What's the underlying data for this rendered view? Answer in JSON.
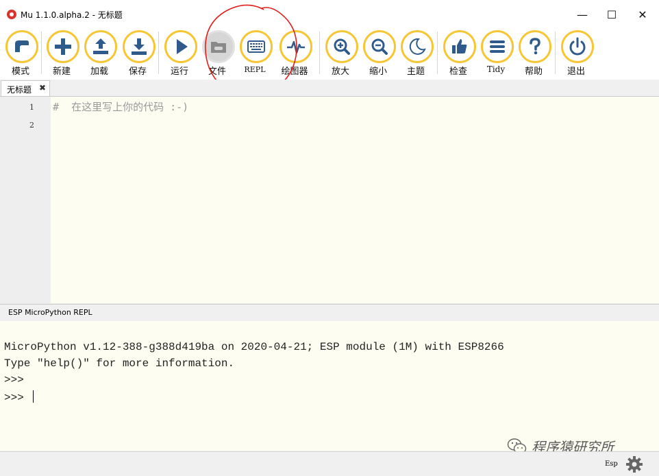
{
  "window": {
    "title": "Mu 1.1.0.alpha.2 - 无标题",
    "minimize": "—",
    "maximize": "☐",
    "close": "✕"
  },
  "toolbar": {
    "buttons": [
      {
        "label": "模式",
        "icon": "mode-icon"
      },
      {
        "label": "新建",
        "icon": "plus-icon"
      },
      {
        "label": "加载",
        "icon": "upload-icon"
      },
      {
        "label": "保存",
        "icon": "download-icon"
      },
      {
        "label": "运行",
        "icon": "play-icon"
      },
      {
        "label": "文件",
        "icon": "folder-icon",
        "disabled": true
      },
      {
        "label": "REPL",
        "icon": "keyboard-icon"
      },
      {
        "label": "绘图器",
        "icon": "pulse-icon"
      },
      {
        "label": "放大",
        "icon": "zoom-in-icon"
      },
      {
        "label": "缩小",
        "icon": "zoom-out-icon"
      },
      {
        "label": "主题",
        "icon": "moon-icon"
      },
      {
        "label": "检查",
        "icon": "thumbs-up-icon"
      },
      {
        "label": "Tidy",
        "icon": "tidy-lines-icon"
      },
      {
        "label": "帮助",
        "icon": "question-icon"
      },
      {
        "label": "退出",
        "icon": "power-icon"
      }
    ]
  },
  "tabs": [
    {
      "label": "无标题",
      "close": "✖"
    }
  ],
  "editor": {
    "line_numbers": [
      "1",
      "2"
    ],
    "lines": [
      "#  在这里写上你的代码 :-)",
      ""
    ]
  },
  "repl": {
    "title": "ESP MicroPython REPL",
    "lines": [
      "MicroPython v1.12-388-g388d419ba on 2020-04-21; ESP module (1M) with ESP8266",
      "Type \"help()\" for more information.",
      ">>>",
      ">>> "
    ]
  },
  "watermark": {
    "text": "程序猿研究所"
  },
  "status": {
    "mode": "Esp"
  },
  "colors": {
    "accent_ring": "#f7c634",
    "icon": "#2f5b8c",
    "editor_bg": "#fefdf2",
    "annotation": "#e0201c"
  }
}
